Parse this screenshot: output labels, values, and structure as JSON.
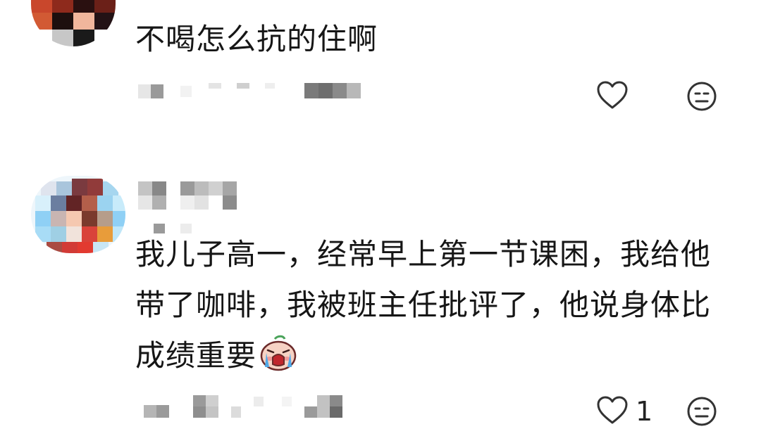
{
  "comments": [
    {
      "text": "不喝怎么抗的住啊",
      "like_count": "",
      "icons": [
        "heart-outline-icon",
        "neutral-face-icon"
      ]
    },
    {
      "text": "我儿子高一，经常早上第一节课困，我给他带了咖啡，我被班主任批评了，他说身体比成绩重要",
      "like_count": "1",
      "icons": [
        "heart-outline-icon",
        "neutral-face-icon",
        "crying-emoji-icon"
      ]
    }
  ],
  "colors": {
    "text": "#161616",
    "icon_stroke": "#333333",
    "censor_gray": "#8a8a8a"
  }
}
